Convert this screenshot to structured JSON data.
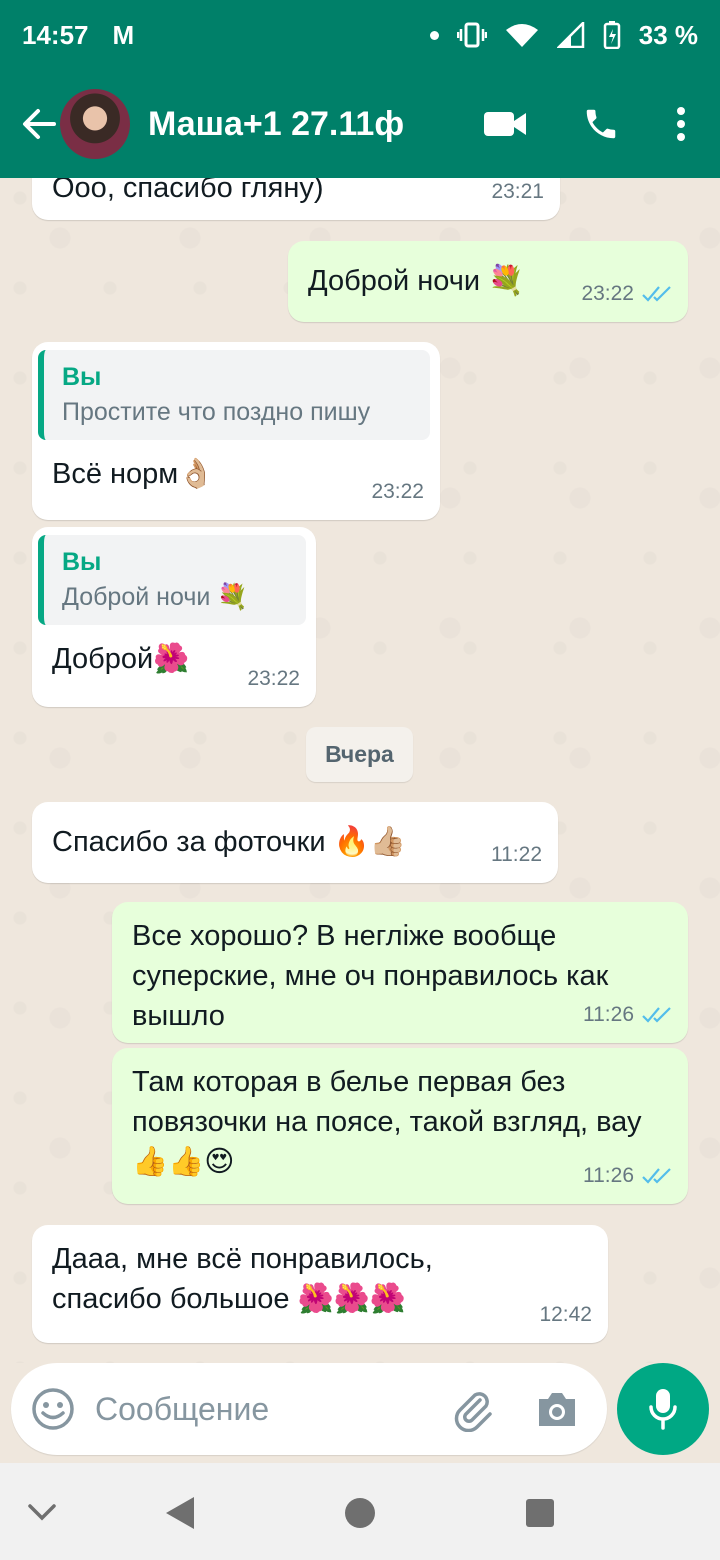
{
  "status": {
    "time": "14:57",
    "gmail": "M",
    "battery": "33 %"
  },
  "header": {
    "title": "Маша+1 27.11ф",
    "icons": [
      "back-arrow-icon",
      "video-call-icon",
      "phone-icon",
      "more-vert-icon"
    ]
  },
  "messages": [
    {
      "dir": "in",
      "text": "Ооо, спасибо гляну)",
      "time": "23:21"
    },
    {
      "dir": "out",
      "text": "Доброй ночи 💐",
      "time": "23:22",
      "read": true
    },
    {
      "dir": "in",
      "quote_name": "Вы",
      "quote_text": "Простите что поздно пишу",
      "text": "Всё норм👌🏼",
      "time": "23:22"
    },
    {
      "dir": "in",
      "quote_name": "Вы",
      "quote_text": "Доброй ночи 💐",
      "text": "Доброй🌺",
      "time": "23:22"
    },
    {
      "dir": "in",
      "text": "Спасибо за фоточки 🔥👍🏼",
      "time": "11:22"
    },
    {
      "dir": "out",
      "text": "Все хорошо? В негліже вообще суперские, мне оч понравилось как вышло",
      "time": "11:26",
      "read": true
    },
    {
      "dir": "out",
      "text": "Там которая в белье первая без повязочки на поясе, такой взгляд, вау 👍👍😍",
      "time": "11:26",
      "read": true
    },
    {
      "dir": "in",
      "text": "Дааа, мне всё понравилось, спасибо большое 🌺🌺🌺",
      "time": "12:42"
    }
  ],
  "date_chip": "Вчера",
  "composer": {
    "placeholder": "Сообщение"
  },
  "colors": {
    "header": "#008069",
    "accent": "#00a884",
    "outgoing": "#e7ffdb",
    "incoming": "#ffffff",
    "read_ticks": "#53bdeb"
  }
}
